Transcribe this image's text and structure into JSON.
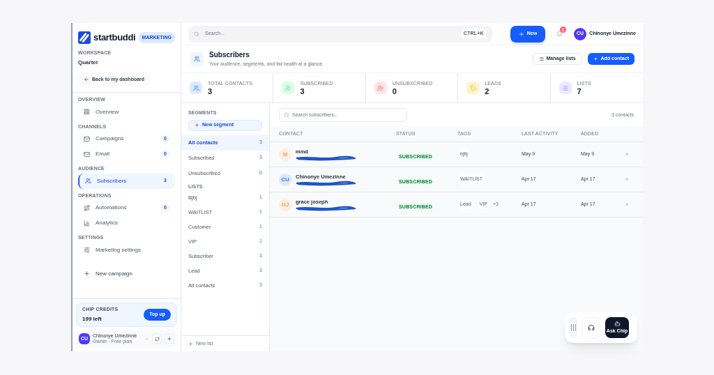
{
  "brand": {
    "name": "startbuddi",
    "badge": "MARKETING"
  },
  "workspace": {
    "label": "WORKSPACE",
    "name": "Quarter"
  },
  "back_button": "Back to my dashboard",
  "nav_sections": [
    {
      "title": "OVERVIEW",
      "items": [
        {
          "label": "Overview",
          "selected": false
        }
      ]
    },
    {
      "title": "CHANNELS",
      "items": [
        {
          "label": "Campaigns",
          "count": "0",
          "selected": false
        },
        {
          "label": "Email",
          "count": "0",
          "selected": false
        }
      ]
    },
    {
      "title": "AUDIENCE",
      "items": [
        {
          "label": "Subscribers",
          "count": "3",
          "selected": true
        }
      ]
    },
    {
      "title": "OPERATIONS",
      "items": [
        {
          "label": "Automations",
          "count": "0",
          "selected": false
        },
        {
          "label": "Analytics",
          "selected": false
        }
      ]
    },
    {
      "title": "SETTINGS",
      "items": [
        {
          "label": "Marketing settings",
          "selected": false
        }
      ]
    }
  ],
  "new_campaign": "New campaign",
  "credits": {
    "label": "CHIP CREDITS",
    "value": "199 left",
    "button": "Top up"
  },
  "account": {
    "initials": "CU",
    "name": "Chinonye Umezinne",
    "role": "Owner · Free plan"
  },
  "topbar": {
    "search_placeholder": "Search...",
    "shortcut": "CTRL+K",
    "new_button": "New",
    "notifications": "1",
    "user_initials": "CU",
    "user_name": "Chinonye Umezinne"
  },
  "page": {
    "title": "Subscribers",
    "subtitle": "Your audience, segments, and list health at a glance.",
    "buttons": [
      "Manage lists",
      "Add contact"
    ]
  },
  "stats": [
    {
      "label": "TOTAL CONTACTS",
      "value": "3",
      "color": "#dbeafe"
    },
    {
      "label": "SUBSCRIBED",
      "value": "3",
      "color": "#dcfce7"
    },
    {
      "label": "UNSUBSCRIBED",
      "value": "0",
      "color": "#ffe4e6"
    },
    {
      "label": "LEADS",
      "value": "2",
      "color": "#fef3c7"
    },
    {
      "label": "LISTS",
      "value": "7",
      "color": "#ede9fe"
    }
  ],
  "segments": {
    "title": "SEGMENTS",
    "new_button": "New segment",
    "items": [
      {
        "label": "All contacts",
        "count": "3",
        "selected": true
      },
      {
        "label": "Subscribed",
        "count": "3",
        "selected": false
      },
      {
        "label": "Unsubscribed",
        "count": "0",
        "selected": false
      }
    ],
    "lists_title": "LISTS",
    "lists": [
      {
        "label": "Bjbj",
        "count": "1",
        "selected": false
      },
      {
        "label": "WAITLIST",
        "count": "1",
        "selected": false
      },
      {
        "label": "Customer",
        "count": "1",
        "selected": false
      },
      {
        "label": "VIP",
        "count": "1",
        "selected": false
      },
      {
        "label": "Subscriber",
        "count": "3",
        "selected": false
      },
      {
        "label": "Lead",
        "count": "3",
        "selected": false
      },
      {
        "label": "All contacts",
        "count": "3",
        "selected": false
      }
    ],
    "new_list": "New list"
  },
  "table": {
    "search_placeholder": "Search subscribers...",
    "count": "3 contacts",
    "columns": [
      "CONTACT",
      "STATUS",
      "TAGS",
      "LAST ACTIVITY",
      "ADDED"
    ],
    "rows": [
      {
        "initials": "M",
        "name": "mmd",
        "color": "#f5a25d",
        "status": "SUBSCRIBED",
        "tags": [
          "bjbj"
        ],
        "last_activity": "May 9",
        "added": "May 9"
      },
      {
        "initials": "CU",
        "name": "Chinonye Umezinne",
        "color": "#3b82f6",
        "status": "SUBSCRIBED",
        "tags": [
          "WAITLIST"
        ],
        "last_activity": "Apr 17",
        "added": "Apr 17"
      },
      {
        "initials": "GJ",
        "name": "grace joseph",
        "color": "#f5a25d",
        "status": "SUBSCRIBED",
        "tags": [
          "Lead",
          "VIP"
        ],
        "more_tags": "+3",
        "last_activity": "Apr 17",
        "added": "Apr 17"
      }
    ]
  },
  "dock": {
    "ask_label": "Ask Chip"
  }
}
